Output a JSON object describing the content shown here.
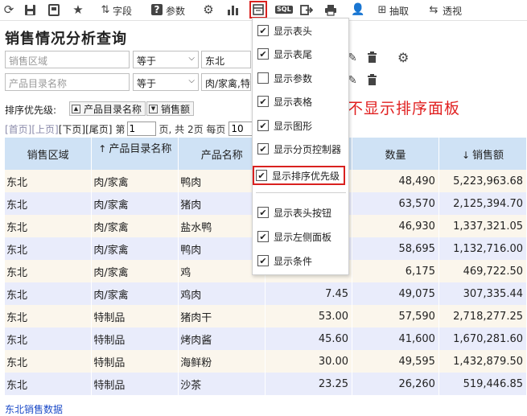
{
  "toolbar": {
    "items": [
      {
        "name": "refresh",
        "icon": "refresh-icon",
        "glyph": "⟳"
      },
      {
        "name": "save",
        "icon": "save-icon",
        "glyph": "▣"
      },
      {
        "name": "save-as",
        "icon": "save-as-icon",
        "glyph": "▤"
      },
      {
        "name": "favorite",
        "icon": "star-icon",
        "glyph": "★"
      }
    ],
    "field_label": "字段",
    "param_label": "参数",
    "extract_label": "抽取",
    "pivot_label": "透视",
    "sql_text": "SQL"
  },
  "page_title": "销售情况分析查询",
  "filters": {
    "row1": {
      "field_placeholder": "销售区域",
      "operator": "等于",
      "value": "东北"
    },
    "row2": {
      "field_placeholder": "产品目录名称",
      "operator": "等于",
      "value": "肉/家禽,特"
    }
  },
  "sort": {
    "label": "排序优先级:",
    "chips": [
      "产品目录名称",
      "销售额"
    ]
  },
  "annotation": "不显示排序面板",
  "pager": {
    "first": "[首页]",
    "prev": "[上页]",
    "next": "[下页]",
    "last": "[尾页]",
    "page_prefix": "第",
    "page_value": "1",
    "page_suffix": "页, 共 2页 每页",
    "page_size": "10"
  },
  "table": {
    "headers": [
      "销售区域",
      "产品目录名称",
      "产品名称",
      "",
      "数量",
      "销售额"
    ],
    "header_sort": [
      "",
      "↑",
      "",
      "",
      "",
      "↓"
    ],
    "rows": [
      [
        "东北",
        "肉/家禽",
        "鸭肉",
        "",
        "48,490",
        "5,223,963.68"
      ],
      [
        "东北",
        "肉/家禽",
        "猪肉",
        "",
        "63,570",
        "2,125,394.70"
      ],
      [
        "东北",
        "肉/家禽",
        "盐水鸭",
        "",
        "46,930",
        "1,337,321.05"
      ],
      [
        "东北",
        "肉/家禽",
        "鸭肉",
        "",
        "58,695",
        "1,132,716.00"
      ],
      [
        "东北",
        "肉/家禽",
        "鸡",
        "",
        "6,175",
        "469,722.50"
      ],
      [
        "东北",
        "肉/家禽",
        "鸡肉",
        "7.45",
        "49,075",
        "307,335.44"
      ],
      [
        "东北",
        "特制品",
        "猪肉干",
        "53.00",
        "57,590",
        "2,718,277.25"
      ],
      [
        "东北",
        "特制品",
        "烤肉酱",
        "45.60",
        "41,600",
        "1,670,281.60"
      ],
      [
        "东北",
        "特制品",
        "海鲜粉",
        "30.00",
        "49,595",
        "1,432,879.50"
      ],
      [
        "东北",
        "特制品",
        "沙茶",
        "23.25",
        "26,260",
        "519,446.85"
      ]
    ]
  },
  "footer_link": "东北销售数据",
  "menu": {
    "items": [
      {
        "label": "显示表头",
        "checked": true
      },
      {
        "label": "显示表尾",
        "checked": true
      },
      {
        "label": "显示参数",
        "checked": false
      },
      {
        "label": "显示表格",
        "checked": true
      },
      {
        "label": "显示图形",
        "checked": true
      },
      {
        "label": "显示分页控制器",
        "checked": true
      },
      {
        "label": "显示排序优先级",
        "checked": true
      },
      {
        "label": "显示表头按钮",
        "checked": true
      },
      {
        "label": "显示左侧面板",
        "checked": true
      },
      {
        "label": "显示条件",
        "checked": true
      }
    ]
  },
  "colors": {
    "header_bg": "#cfe2f5",
    "row_odd": "#fbf6ec",
    "row_even": "#e9ecfb",
    "highlight": "#d9211f",
    "link": "#1a49c7"
  }
}
